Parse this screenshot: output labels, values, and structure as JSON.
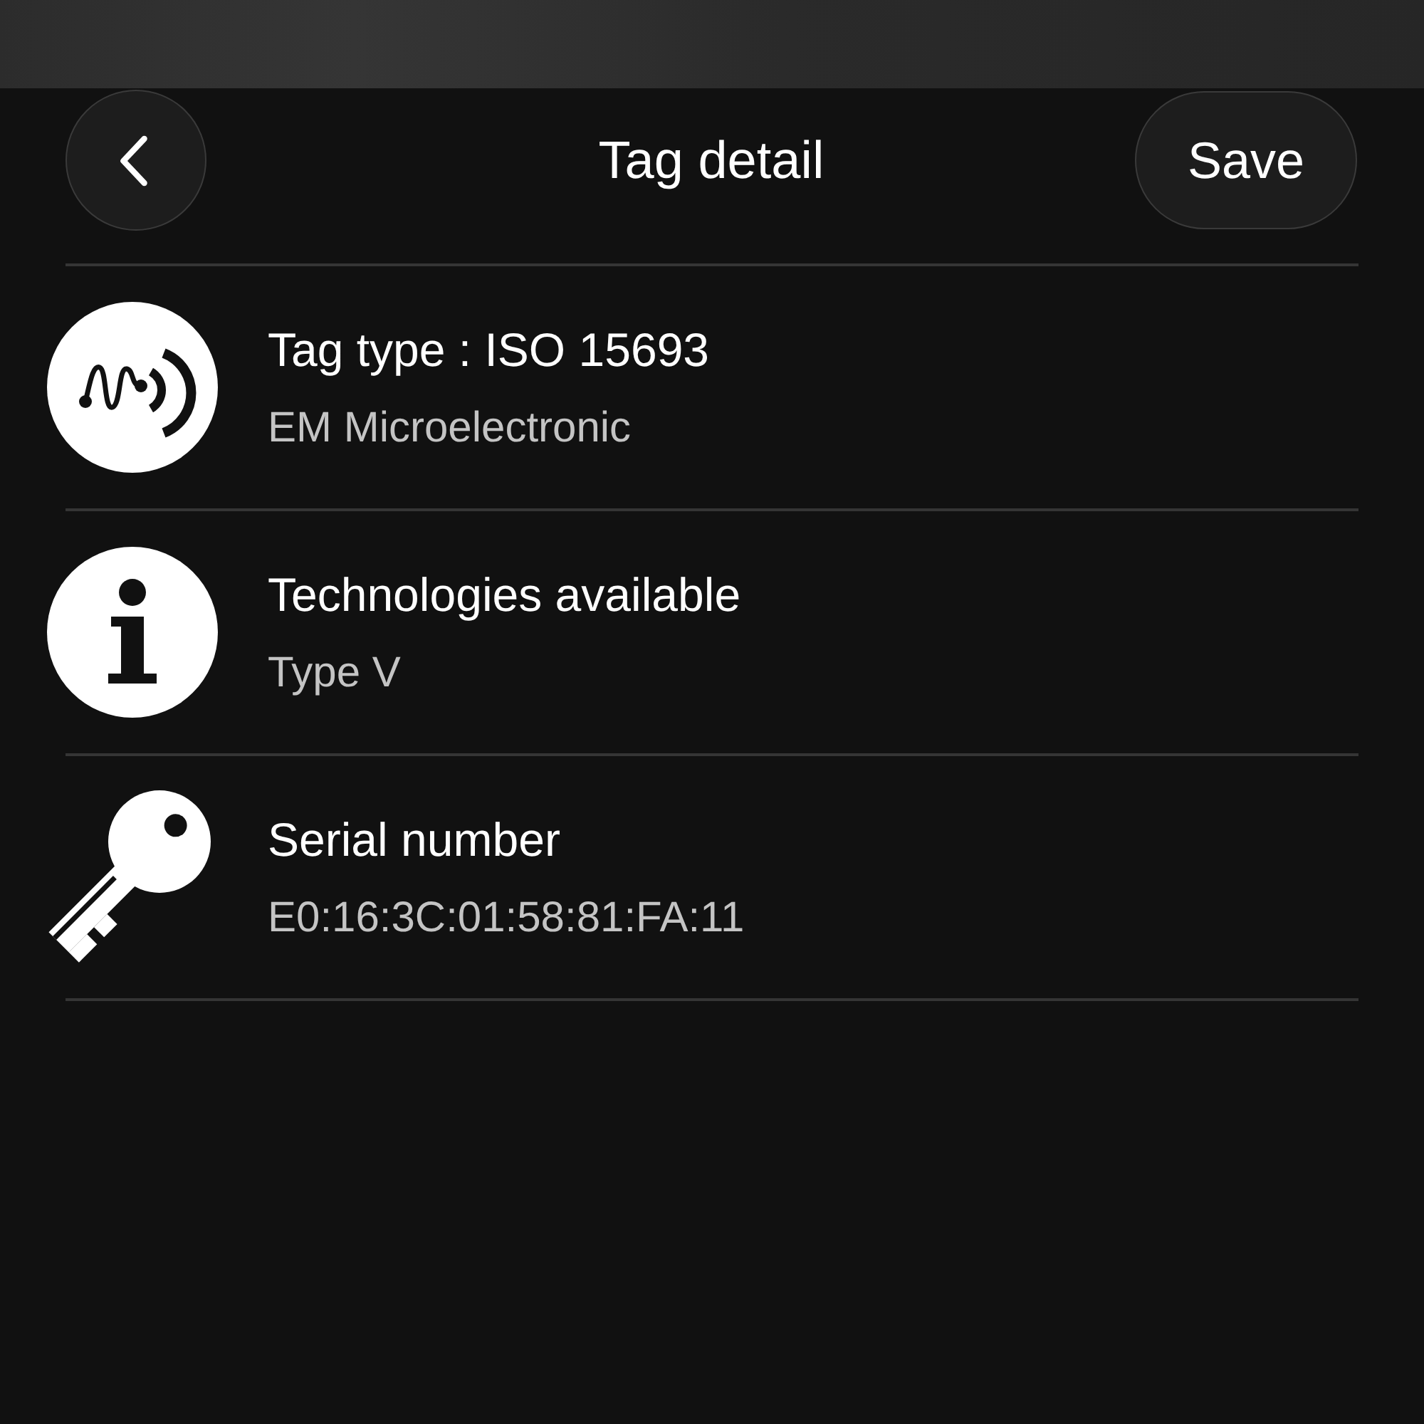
{
  "header": {
    "title": "Tag detail",
    "action": "Save"
  },
  "rows": [
    {
      "kind": "tag_type",
      "title": "Tag type : ISO 15693",
      "subtitle": "EM Microelectronic"
    },
    {
      "kind": "info",
      "title": "Technologies available",
      "subtitle": "Type V"
    },
    {
      "kind": "serial",
      "title": "Serial number",
      "subtitle": "E0:16:3C:01:58:81:FA:11"
    }
  ]
}
